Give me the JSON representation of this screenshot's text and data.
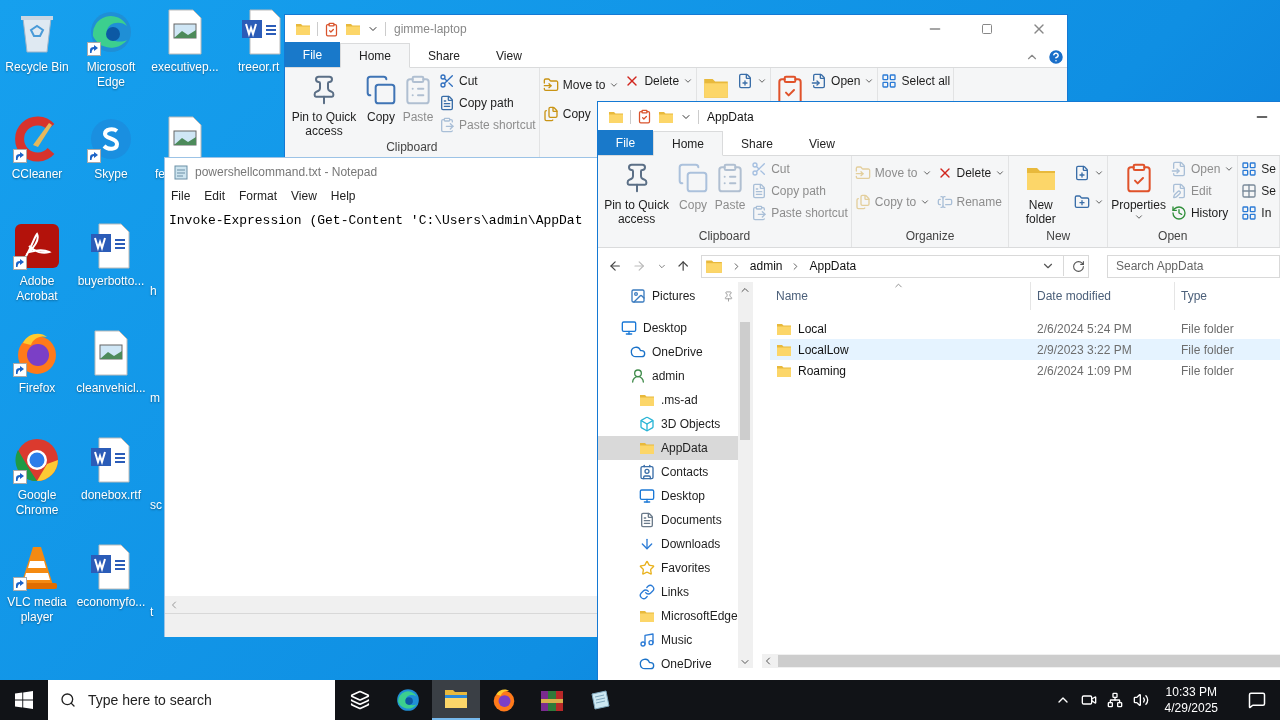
{
  "desktop": {
    "columns": [
      [
        {
          "label": "Recycle Bin",
          "kind": "recycle",
          "shortcut": false
        },
        {
          "label": "CCleaner",
          "kind": "ccleaner",
          "shortcut": true
        },
        {
          "label": "Adobe Acrobat",
          "kind": "acrobat",
          "shortcut": true
        },
        {
          "label": "Firefox",
          "kind": "firefox",
          "shortcut": true
        },
        {
          "label": "Google Chrome",
          "kind": "chrome",
          "shortcut": true
        },
        {
          "label": "VLC media player",
          "kind": "vlc",
          "shortcut": true
        }
      ],
      [
        {
          "label": "Microsoft Edge",
          "kind": "edge",
          "shortcut": true
        },
        {
          "label": "Skype",
          "kind": "skype",
          "shortcut": true
        },
        {
          "label": "buyerbotto...",
          "kind": "word",
          "shortcut": false
        },
        {
          "label": "cleanvehicl...",
          "kind": "image",
          "shortcut": false
        },
        {
          "label": "donebox.rtf",
          "kind": "word",
          "shortcut": false
        },
        {
          "label": "economyfo...",
          "kind": "word",
          "shortcut": false
        }
      ],
      [
        {
          "label": "executivep...",
          "kind": "image",
          "shortcut": false
        },
        {
          "label": "fe",
          "kind": "image-cut",
          "shortcut": false
        },
        {
          "label": "h",
          "kind": "covered"
        },
        {
          "label": "m",
          "kind": "covered"
        },
        {
          "label": "sc",
          "kind": "covered"
        },
        {
          "label": "t",
          "kind": "covered"
        }
      ],
      [
        {
          "label": "treeor.rt",
          "kind": "word-cut",
          "shortcut": false
        }
      ]
    ]
  },
  "back_explorer": {
    "title": "gimme-laptop",
    "tabs": [
      {
        "label": "File",
        "kind": "file",
        "selected": false
      },
      {
        "label": "Home",
        "kind": "tab",
        "selected": true
      },
      {
        "label": "Share",
        "kind": "tab",
        "selected": false
      },
      {
        "label": "View",
        "kind": "tab",
        "selected": false
      }
    ],
    "ribbon": [
      {
        "label": "Clipboard",
        "columns": [
          [
            {
              "label": "Pin to Quick access",
              "kind": "pin",
              "disabled": false,
              "menu": false
            }
          ],
          [
            {
              "label": "Copy",
              "kind": "copy",
              "disabled": false,
              "menu": false
            }
          ],
          [
            {
              "label": "Paste",
              "kind": "paste",
              "disabled": true,
              "menu": false
            }
          ],
          [
            {
              "label": "Cut",
              "kind": "cut",
              "disabled": false,
              "menu": false
            },
            {
              "label": "Copy path",
              "kind": "copy-path",
              "disabled": false,
              "menu": false
            },
            {
              "label": "Paste shortcut",
              "kind": "paste-shortcut",
              "disabled": true,
              "menu": false
            }
          ]
        ]
      },
      {
        "columns": [
          [
            {
              "label": "Move to",
              "kind": "move-to",
              "disabled": false,
              "menu": true
            },
            {
              "label": "Copy",
              "kind": "copy-to",
              "disabled": false,
              "menu": false
            }
          ],
          [
            {
              "label": "Delete",
              "kind": "delete",
              "disabled": false,
              "menu": true
            }
          ]
        ]
      },
      {
        "columns": [
          [
            {
              "kind": "new-folder",
              "disabled": false,
              "menu": false
            }
          ],
          [
            {
              "kind": "new-item",
              "disabled": false,
              "menu": true
            }
          ]
        ]
      },
      {
        "columns": [
          [
            {
              "kind": "properties",
              "disabled": false,
              "menu": false
            }
          ],
          [
            {
              "label": "Open",
              "kind": "open",
              "disabled": false,
              "menu": true
            }
          ]
        ]
      },
      {
        "columns": [
          [
            {
              "label": "Select all",
              "kind": "select-all",
              "disabled": false,
              "menu": false
            }
          ]
        ]
      }
    ]
  },
  "notepad": {
    "title": "powershellcommand.txt - Notepad",
    "menu": [
      "File",
      "Edit",
      "Format",
      "View",
      "Help"
    ],
    "text": "Invoke-Expression (Get-Content 'C:\\Users\\admin\\AppDat"
  },
  "front_explorer": {
    "title": "AppData",
    "tabs": [
      {
        "label": "File",
        "kind": "file",
        "selected": false
      },
      {
        "label": "Home",
        "kind": "tab",
        "selected": true
      },
      {
        "label": "Share",
        "kind": "tab",
        "selected": false
      },
      {
        "label": "View",
        "kind": "tab",
        "selected": false
      }
    ],
    "ribbon": [
      {
        "label": "Clipboard",
        "columns": [
          [
            {
              "label": "Pin to Quick access",
              "kind": "pin",
              "disabled": false,
              "menu": false
            }
          ],
          [
            {
              "label": "Copy",
              "kind": "copy",
              "disabled": true,
              "menu": false
            }
          ],
          [
            {
              "label": "Paste",
              "kind": "paste",
              "disabled": true,
              "menu": false
            }
          ],
          [
            {
              "label": "Cut",
              "kind": "cut",
              "disabled": true,
              "menu": false
            },
            {
              "label": "Copy path",
              "kind": "copy-path",
              "disabled": true,
              "menu": false
            },
            {
              "label": "Paste shortcut",
              "kind": "paste-shortcut",
              "disabled": true,
              "menu": false
            }
          ]
        ]
      },
      {
        "label": "Organize",
        "columns": [
          [
            {
              "label": "Move to",
              "kind": "move-to",
              "disabled": true,
              "menu": true
            },
            {
              "label": "Copy to",
              "kind": "copy-to",
              "disabled": true,
              "menu": true
            }
          ],
          [
            {
              "label": "Delete",
              "kind": "delete",
              "disabled": false,
              "menu": true
            },
            {
              "label": "Rename",
              "kind": "rename",
              "disabled": true,
              "menu": false
            }
          ]
        ]
      },
      {
        "label": "New",
        "columns": [
          [
            {
              "label": "New folder",
              "kind": "new-folder",
              "disabled": false,
              "menu": false
            }
          ],
          [
            {
              "kind": "new-item",
              "disabled": false,
              "menu": true
            },
            {
              "kind": "easy-access",
              "disabled": false,
              "menu": true
            }
          ]
        ]
      },
      {
        "label": "Open",
        "columns": [
          [
            {
              "label": "Properties",
              "kind": "properties",
              "disabled": false,
              "menu": true
            }
          ],
          [
            {
              "label": "Open",
              "kind": "open",
              "disabled": true,
              "menu": true
            },
            {
              "label": "Edit",
              "kind": "edit",
              "disabled": true,
              "menu": false
            },
            {
              "label": "History",
              "kind": "history",
              "disabled": false,
              "menu": false
            }
          ]
        ]
      },
      {
        "columns": [
          [
            {
              "label": "Se",
              "kind": "select-all",
              "disabled": false,
              "menu": false
            },
            {
              "label": "Se",
              "kind": "select-none",
              "disabled": false,
              "menu": false
            },
            {
              "label": "In",
              "kind": "invert",
              "disabled": false,
              "menu": false
            }
          ]
        ]
      }
    ],
    "address": {
      "crumbs": [
        "admin",
        "AppData"
      ],
      "search_placeholder": "Search AppData"
    },
    "quick_access": [
      {
        "label": "Pictures",
        "kind": "pictures",
        "pinned": true
      }
    ],
    "tree": [
      {
        "label": "Desktop",
        "kind": "desktop",
        "selected": false,
        "children": [
          {
            "label": "OneDrive",
            "kind": "cloud",
            "selected": false
          },
          {
            "label": "admin",
            "kind": "user",
            "selected": false,
            "children": [
              {
                "label": ".ms-ad",
                "kind": "folder",
                "selected": false
              },
              {
                "label": "3D Objects",
                "kind": "cube",
                "selected": false
              },
              {
                "label": "AppData",
                "kind": "folder",
                "selected": true
              },
              {
                "label": "Contacts",
                "kind": "contacts",
                "selected": false
              },
              {
                "label": "Desktop",
                "kind": "desktop",
                "selected": false
              },
              {
                "label": "Documents",
                "kind": "documents",
                "selected": false
              },
              {
                "label": "Downloads",
                "kind": "downloads",
                "selected": false
              },
              {
                "label": "Favorites",
                "kind": "star",
                "selected": false
              },
              {
                "label": "Links",
                "kind": "links",
                "selected": false
              },
              {
                "label": "MicrosoftEdge",
                "kind": "folder",
                "selected": false
              },
              {
                "label": "Music",
                "kind": "music",
                "selected": false
              },
              {
                "label": "OneDrive",
                "kind": "cloud",
                "selected": false
              }
            ]
          }
        ]
      }
    ],
    "columns": [
      "Name",
      "Date modified",
      "Type"
    ],
    "rows": [
      {
        "name": "Local",
        "date": "2/6/2024 5:24 PM",
        "type": "File folder",
        "selected": false
      },
      {
        "name": "LocalLow",
        "date": "2/9/2023 3:22 PM",
        "type": "File folder",
        "selected": true
      },
      {
        "name": "Roaming",
        "date": "2/6/2024 1:09 PM",
        "type": "File folder",
        "selected": false
      }
    ]
  },
  "taskbar": {
    "search_placeholder": "Type here to search",
    "apps": [
      {
        "kind": "taskview",
        "active": false
      },
      {
        "kind": "edge",
        "active": false
      },
      {
        "kind": "explorer",
        "active": true
      },
      {
        "kind": "firefox",
        "active": false
      },
      {
        "kind": "winrar",
        "active": false
      },
      {
        "kind": "notepad",
        "active": false
      }
    ],
    "time": "10:33 PM",
    "date": "4/29/2025"
  }
}
